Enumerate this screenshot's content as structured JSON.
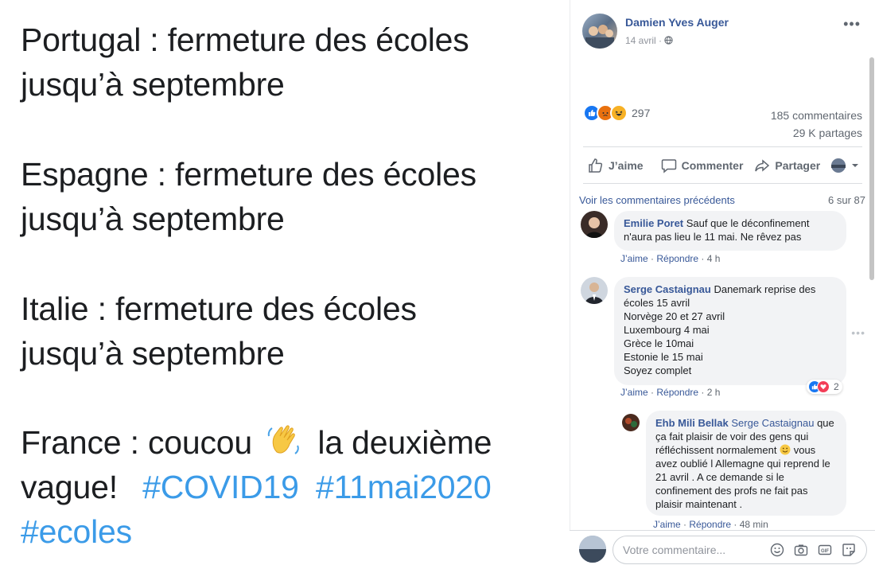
{
  "post": {
    "lines": [
      "Portugal : fermeture des écoles",
      "jusqu’à septembre",
      "Espagne : fermeture des écoles",
      "jusqu’à septembre",
      "Italie : fermeture des écoles",
      "jusqu’à septembre"
    ],
    "france_before": "France : coucou",
    "france_after": "la deuxième",
    "vague": "vague!",
    "hashtags": [
      "#COVID19",
      "#11mai2020",
      "#ecoles"
    ]
  },
  "header": {
    "author": "Damien Yves Auger",
    "date": "14 avril · ",
    "privacy_icon": "globe-icon"
  },
  "reactions": {
    "icons": [
      "like-icon",
      "angry-icon",
      "haha-icon"
    ],
    "count": "297",
    "comments": "185 commentaires",
    "shares": "29 K partages"
  },
  "actions": {
    "like": "J’aime",
    "comment": "Commenter",
    "share": "Partager"
  },
  "comments_section": {
    "previous": "Voir les commentaires précédents",
    "count": "6 sur 87"
  },
  "comments": [
    {
      "author": "Emilie Poret",
      "lines": [
        "Sauf que le déconfinement",
        "n'aura pas lieu le 11 mai. Ne rêvez pas"
      ],
      "like": "J’aime",
      "reply": "Répondre",
      "time": "4 h"
    },
    {
      "author": "Serge Castaignau",
      "lines": [
        "Danemark reprise des",
        "écoles 15 avril",
        "Norvège 20 et 27 avril",
        "Luxembourg 4 mai",
        "Grèce le 10mai",
        "Estonie le 15 mai",
        "Soyez complet"
      ],
      "like": "J’aime",
      "reply": "Répondre",
      "time": "2 h",
      "reaction_count": "2"
    },
    {
      "author": "Ehb Mili Bellak",
      "mention": "Serge Castaignau",
      "lines": [
        "que",
        "ça fait plaisir de voir des gens qui",
        "réfléchissent normalement",
        "vous",
        "avez oublié l Allemagne qui reprend le",
        "21 avril . A ce demande si le",
        "confinement des profs ne fait pas",
        "plaisir maintenant ."
      ],
      "like": "J’aime",
      "reply": "Répondre",
      "time": "48 min"
    }
  ],
  "composer": {
    "placeholder": "Votre commentaire...",
    "icons": [
      "emoji-icon",
      "camera-icon",
      "gif-icon",
      "sticker-icon"
    ]
  },
  "colors": {
    "link": "#385898",
    "hashtag": "#3b9be8",
    "bubble": "#f2f3f5"
  }
}
